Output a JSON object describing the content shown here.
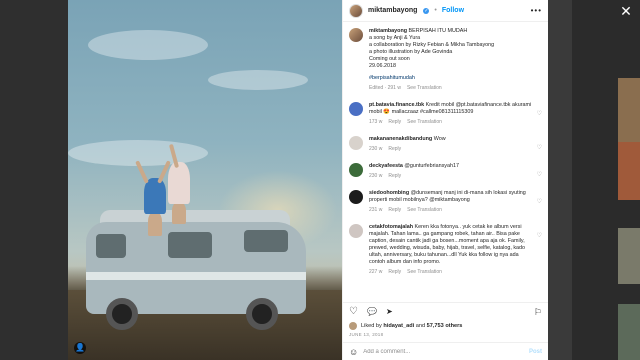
{
  "window": {
    "close_symbol": "✕"
  },
  "post": {
    "username": "miktambayong",
    "verified_symbol": "✓",
    "separator": "•",
    "follow_label": "Follow",
    "more_symbol": "•••",
    "photo_tag_symbol": "👤"
  },
  "caption": {
    "username": "miktambayong",
    "lines": [
      "BERPISAH ITU MUDAH",
      "a song by Anji & Yura",
      "a collaboration by Rizky Febian & Mikha Tambayong",
      "a photo illustration by Ade Govinda",
      "Coming out soon",
      "29.06.2018"
    ],
    "hashtag": "#berpisahitumudah",
    "meta_age": "Edited · 291 w",
    "meta_translation": "See Translation"
  },
  "comments": [
    {
      "username": "pt.batavia.finance.tbk",
      "text": "Kredit mobil @pt.bataviafinance.tbk akurami mobil 😍 mallaczaaz #callme081311115309",
      "age": "173 w",
      "reply": "Reply",
      "translation": "See Translation",
      "avatar_color": "#4a6fc4"
    },
    {
      "username": "makananenakdibandung",
      "text": "Wow",
      "age": "230 w",
      "reply": "Reply",
      "translation": "",
      "avatar_color": "#d8d2cc"
    },
    {
      "username": "deckyafeesta",
      "text": "@gunturfebriansyah17",
      "age": "230 w",
      "reply": "Reply",
      "translation": "",
      "avatar_color": "#3c6b3a"
    },
    {
      "username": "siedoohombing",
      "text": "@dunsemanj manj ini di-mana sih lokasi syuting properti mobil mobilnya? @miktambayong",
      "age": "231 w",
      "reply": "Reply",
      "translation": "See Translation",
      "avatar_color": "#1c1c1c"
    },
    {
      "username": "cetakfotomajalah",
      "text": "Keren kka fotonya.. yuk cetak ke album versi majalah. Tahan lama.. ga gampang robek, tahan air.. Bisa pake caption, desain cantik jadi ga bosen...moment apa aja ok. Family, prewed, wedding, wisuda, baby, hijab, travel, selfie, katalog, kado ultah, anniversary, buku tahunan...dll Yuk kka follow ig nya ada contoh album dan info promo.",
      "age": "227 w",
      "reply": "Reply",
      "translation": "See Translation",
      "avatar_color": "#cfc6c2"
    }
  ],
  "actions": {
    "like_icon": "♡",
    "comment_icon": "💬",
    "share_icon": "➤",
    "save_icon": "⚐"
  },
  "likes": {
    "prefix": "Liked by",
    "first_user": "hidayat_adi",
    "connector": "and",
    "others": "57,753 others"
  },
  "date": "JUNE 13, 2018",
  "add_comment": {
    "emoji_icon": "☺",
    "placeholder": "Add a comment...",
    "post_label": "Post"
  }
}
